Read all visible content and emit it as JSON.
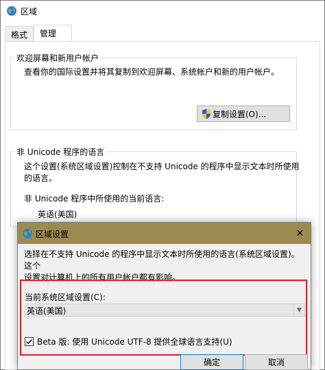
{
  "window": {
    "title": "区域",
    "icon": "globe-icon"
  },
  "tabs": [
    {
      "label": "格式",
      "selected": false
    },
    {
      "label": "管理",
      "selected": true
    }
  ],
  "welcome_group": {
    "label": "欢迎屏幕和新用户帐户",
    "description": "查看你的国际设置并将其复制到欢迎屏幕、系统帐户和新的用户帐户。",
    "copy_button": "复制设置(O)...",
    "copy_button_icon": "uac-shield-icon"
  },
  "unicode_group": {
    "label": "非 Unicode 程序的语言",
    "description_line1": "这个设置(系统区域设置)控制在不支持 Unicode 的程序中显示文本时所使用",
    "description_line2": "的语言。",
    "current_label": "非 Unicode 程序中所使用的当前语言:",
    "current_value": "英语(美国)"
  },
  "dialog": {
    "title": "区域设置",
    "title_bar_color": "#9c8a52",
    "close_glyph": "✕",
    "description_line1": "选择在不支持 Unicode 的程序中显示文本时所使用的语言(系统区域设置)。这个",
    "description_line2": "设置对计算机上的所有用户帐户都有影响。",
    "current_label": "当前系统区域设置(C):",
    "locale_value": "英语(美国)",
    "beta_checkbox_label": "Beta 版: 使用 Unicode UTF-8 提供全球语言支持(U)",
    "beta_checked": true,
    "highlight_color": "#e21b23",
    "ok_button": "确定",
    "cancel_button": "取消"
  }
}
